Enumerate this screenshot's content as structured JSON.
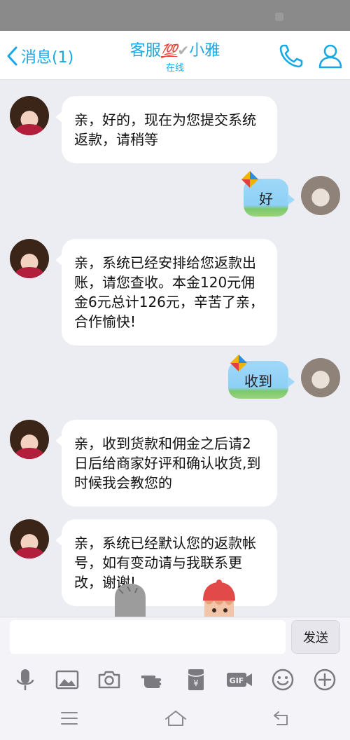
{
  "header": {
    "back_label": "消息(1)",
    "title_prefix": "客服",
    "title_badge": "💯",
    "title_check": "✔",
    "title_suffix": "小雅",
    "status": "在线"
  },
  "messages": [
    {
      "side": "left",
      "text": "亲，好的，现在为您提交系统返款，请稍等"
    },
    {
      "side": "right",
      "text": "好"
    },
    {
      "side": "left",
      "text": "亲，系统已经安排给您返款出账，请您查收。本金120元佣金6元总计126元，辛苦了亲，合作愉快!"
    },
    {
      "side": "right",
      "text": "收到"
    },
    {
      "side": "left",
      "text": "亲，收到货款和佣金之后请2日后给商家好评和确认收货,到时候我会教您的"
    },
    {
      "side": "left",
      "text": "亲，系统已经默认您的返款帐号，如有变动请与我联系更改，谢谢!"
    }
  ],
  "composer": {
    "placeholder": "",
    "send_label": "发送"
  },
  "toolbar": {
    "icons": [
      "microphone-icon",
      "image-icon",
      "camera-icon",
      "pointing-hand-icon",
      "red-envelope-icon",
      "gif-icon",
      "emoji-icon",
      "plus-icon"
    ],
    "gif_label": "GIF",
    "yuan_label": "¥"
  },
  "navbar": {
    "icons": [
      "menu-icon",
      "home-icon",
      "back-icon"
    ]
  },
  "colors": {
    "accent": "#16a9e6",
    "chat_background": "#ececf3",
    "bubble": "#ffffff",
    "kite_bubble": "#9fd8f8"
  }
}
